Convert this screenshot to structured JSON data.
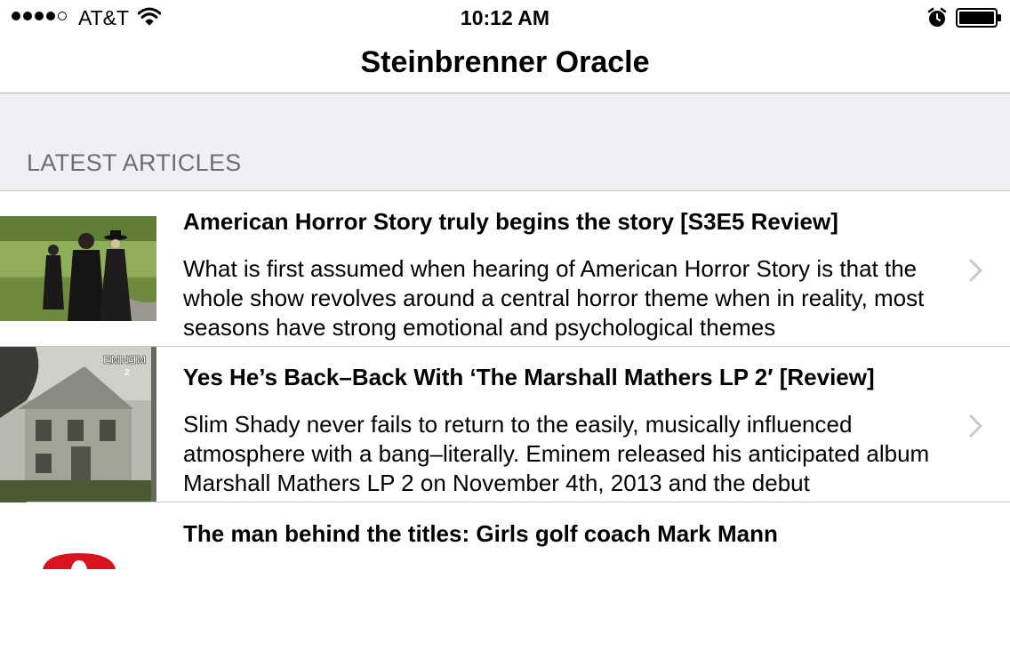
{
  "status_bar": {
    "carrier": "AT&T",
    "time": "10:12 AM",
    "signal_strength": 4,
    "signal_max": 5,
    "icons": [
      "wifi-icon",
      "alarm-icon",
      "battery-icon"
    ]
  },
  "nav": {
    "title": "Steinbrenner Oracle"
  },
  "section": {
    "label": "LATEST ARTICLES"
  },
  "articles": [
    {
      "title": "American Horror Story truly begins the story [S3E5 Review]",
      "summary": "What is first assumed when hearing of American Horror Story is that the whole show revolves around a central horror theme when in reality, most seasons have strong emotional and psychological themes",
      "thumbnail": "tv-show-cast-photo"
    },
    {
      "title": "Yes He’s Back–Back With ‘The Marshall Mathers LP 2′ [Review]",
      "summary": "Slim Shady never fails to return to the easily, musically influenced atmosphere with a bang–literally. Eminem released his anticipated album Marshall Mathers LP 2 on November 4th, 2013 and the debut",
      "thumbnail": "album-cover",
      "thumbnail_text": "EMNƎM",
      "thumbnail_subtext": "2"
    },
    {
      "title": "The man behind the titles: Girls golf coach Mark Mann",
      "thumbnail": "red-logo"
    }
  ],
  "colors": {
    "section_bg": "#efeff4",
    "section_text": "#6d6d72",
    "separator": "#c8c7cc",
    "chevron": "#c7c7cc"
  }
}
